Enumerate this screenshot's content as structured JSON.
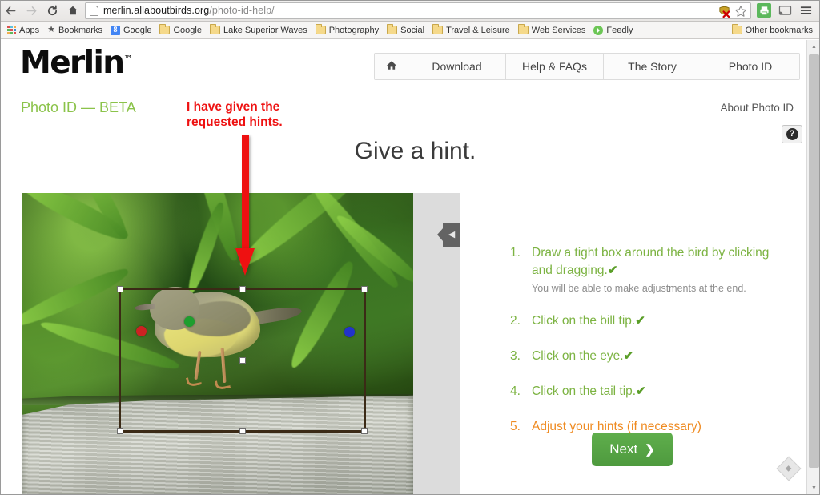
{
  "browser": {
    "back_icon": "back-arrow-icon",
    "forward_icon": "forward-arrow-icon",
    "reload_icon": "reload-icon",
    "home_icon": "home-icon",
    "url_host": "merlin.allaboutbirds.org",
    "url_path": "/photo-id-help/",
    "page_icon": "page-document-icon",
    "omnibox_icons": [
      "adblock-icon",
      "bookmark-star-icon"
    ],
    "toolbar_icons": [
      "print-icon",
      "cast-icon",
      "menu-icon"
    ],
    "bookmarks": [
      {
        "label": "Apps",
        "icon": "apps-grid-icon"
      },
      {
        "label": "Bookmarks",
        "icon": "star-icon"
      },
      {
        "label": "Google",
        "icon": "google-icon"
      },
      {
        "label": "Google",
        "icon": "folder-icon"
      },
      {
        "label": "Lake Superior Waves",
        "icon": "folder-icon"
      },
      {
        "label": "Photography",
        "icon": "folder-icon"
      },
      {
        "label": "Social",
        "icon": "folder-icon"
      },
      {
        "label": "Travel & Leisure",
        "icon": "folder-icon"
      },
      {
        "label": "Web Services",
        "icon": "folder-icon"
      },
      {
        "label": "Feedly",
        "icon": "feedly-icon"
      }
    ],
    "other_bookmarks": {
      "label": "Other bookmarks",
      "icon": "folder-icon"
    }
  },
  "site": {
    "logo": "Merlin",
    "logo_tm": "™",
    "nav": [
      {
        "label": "",
        "icon": "home-icon",
        "name": "home"
      },
      {
        "label": "Download",
        "name": "download"
      },
      {
        "label": "Help & FAQs",
        "name": "help-faqs"
      },
      {
        "label": "The Story",
        "name": "the-story"
      },
      {
        "label": "Photo ID",
        "name": "photo-id"
      }
    ],
    "section_title": "Photo ID — BETA",
    "about_link": "About Photo ID",
    "help_badge": "?"
  },
  "main": {
    "title": "Give a hint.",
    "collapse_tab_icon": "collapse-left-arrow-icon",
    "photo": {
      "alt": "Common Yellowthroat warbler perched on a weathered log amid green foliage",
      "selection_box": "bird-bounding-box",
      "hints": [
        {
          "name": "bill-tip-marker",
          "color": "#cc2222"
        },
        {
          "name": "eye-marker",
          "color": "#1e9e2e"
        },
        {
          "name": "tail-tip-marker",
          "color": "#2233cc"
        }
      ]
    },
    "steps": [
      {
        "num": "1.",
        "text": "Draw a tight box around the bird by clicking and dragging.",
        "done": true,
        "check": "✔",
        "sub": "You will be able to make adjustments at the end."
      },
      {
        "num": "2.",
        "text": "Click on the bill tip.",
        "done": true,
        "check": "✔",
        "sub": ""
      },
      {
        "num": "3.",
        "text": "Click on the eye.",
        "done": true,
        "check": "✔",
        "sub": ""
      },
      {
        "num": "4.",
        "text": "Click on the tail tip.",
        "done": true,
        "check": "✔",
        "sub": ""
      },
      {
        "num": "5.",
        "text": "Adjust your hints (if necessary)",
        "done": false,
        "check": "",
        "sub": ""
      }
    ],
    "next_button": "Next",
    "next_chevron": "❯"
  },
  "annotation": {
    "line1": "I have given the",
    "line2": "requested hints.",
    "arrow": "red-down-arrow",
    "color": "#ee1111"
  },
  "colors": {
    "step_done": "#7cb342",
    "step_pending": "#ef8b22",
    "next_button": "#4e9a3e",
    "brand_green": "#8bc34a"
  },
  "scrollbar": {
    "up_arrow": "▲",
    "down_arrow": "▼",
    "pan_icon": "scroll-pan-icon"
  }
}
